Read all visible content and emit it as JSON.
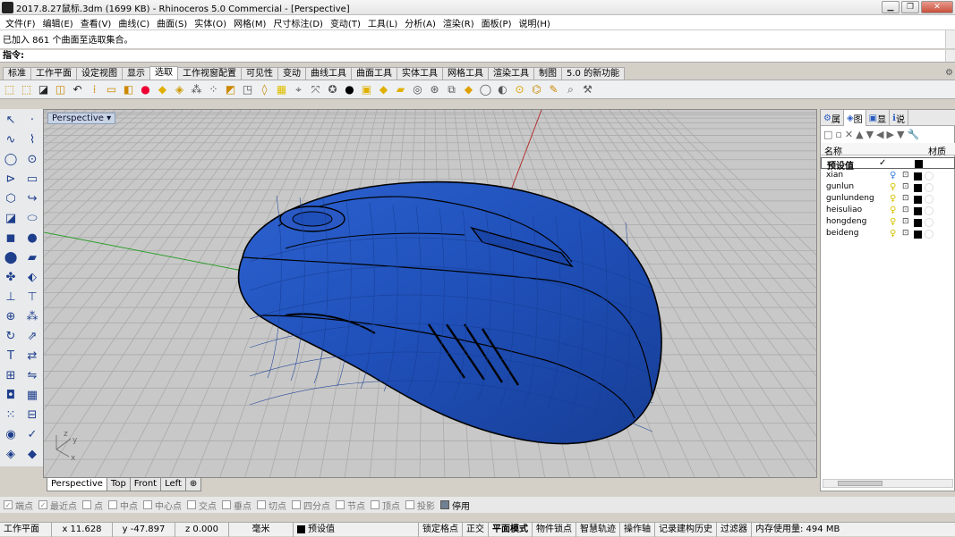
{
  "window": {
    "title": "2017.8.27鼠标.3dm (1699 KB) - Rhinoceros 5.0 Commercial - [Perspective]"
  },
  "menu": [
    "文件(F)",
    "编辑(E)",
    "查看(V)",
    "曲线(C)",
    "曲面(S)",
    "实体(O)",
    "网格(M)",
    "尺寸标注(D)",
    "变动(T)",
    "工具(L)",
    "分析(A)",
    "渲染(R)",
    "面板(P)",
    "说明(H)"
  ],
  "command": {
    "history": "已加入 861 个曲面至选取集合。",
    "prompt": "指令:"
  },
  "tabs": [
    "标准",
    "工作平面",
    "设定视图",
    "显示",
    "选取",
    "工作视窗配置",
    "可见性",
    "变动",
    "曲线工具",
    "曲面工具",
    "实体工具",
    "网格工具",
    "渲染工具",
    "制图",
    "5.0 的新功能"
  ],
  "active_tab": "选取",
  "viewport": {
    "name": "Perspective",
    "tabs": [
      "Perspective",
      "Top",
      "Front",
      "Left"
    ],
    "active_tab": "Perspective",
    "axis_labels": {
      "z": "z",
      "y": "y",
      "x": "x"
    }
  },
  "osnap": [
    {
      "label": "端点",
      "checked": true
    },
    {
      "label": "最近点",
      "checked": true
    },
    {
      "label": "点",
      "checked": false
    },
    {
      "label": "中点",
      "checked": false
    },
    {
      "label": "中心点",
      "checked": false
    },
    {
      "label": "交点",
      "checked": false
    },
    {
      "label": "垂点",
      "checked": false
    },
    {
      "label": "切点",
      "checked": false
    },
    {
      "label": "四分点",
      "checked": false
    },
    {
      "label": "节点",
      "checked": false
    },
    {
      "label": "顶点",
      "checked": false
    },
    {
      "label": "投影",
      "checked": false
    },
    {
      "label": "停用",
      "checked": true
    }
  ],
  "status": {
    "cplane": "工作平面",
    "x": "x 11.628",
    "y": "y -47.897",
    "z": "z 0.000",
    "units": "毫米",
    "layer": "预设值",
    "items": [
      "锁定格点",
      "正交",
      "平面模式",
      "物件锁点",
      "智慧轨迹",
      "操作轴",
      "记录建构历史",
      "过滤器"
    ],
    "memory": "内存使用量: 494 MB"
  },
  "panel": {
    "tabs": [
      "属",
      "图",
      "显",
      "说"
    ],
    "active_tab": "图",
    "header_name": "名称",
    "header_material": "材质",
    "default_layer": "预设值",
    "default_check": "✓",
    "layers": [
      "xian",
      "gunlun",
      "gunlundeng",
      "heisuliao",
      "hongdeng",
      "beideng"
    ]
  },
  "colors": {
    "mouse_body": "#1f4fb8",
    "viewport_bg": "#c8c8c8",
    "grid_line": "#a8a8a8",
    "x_axis": "#b23030",
    "y_axis": "#2e9e2e"
  }
}
